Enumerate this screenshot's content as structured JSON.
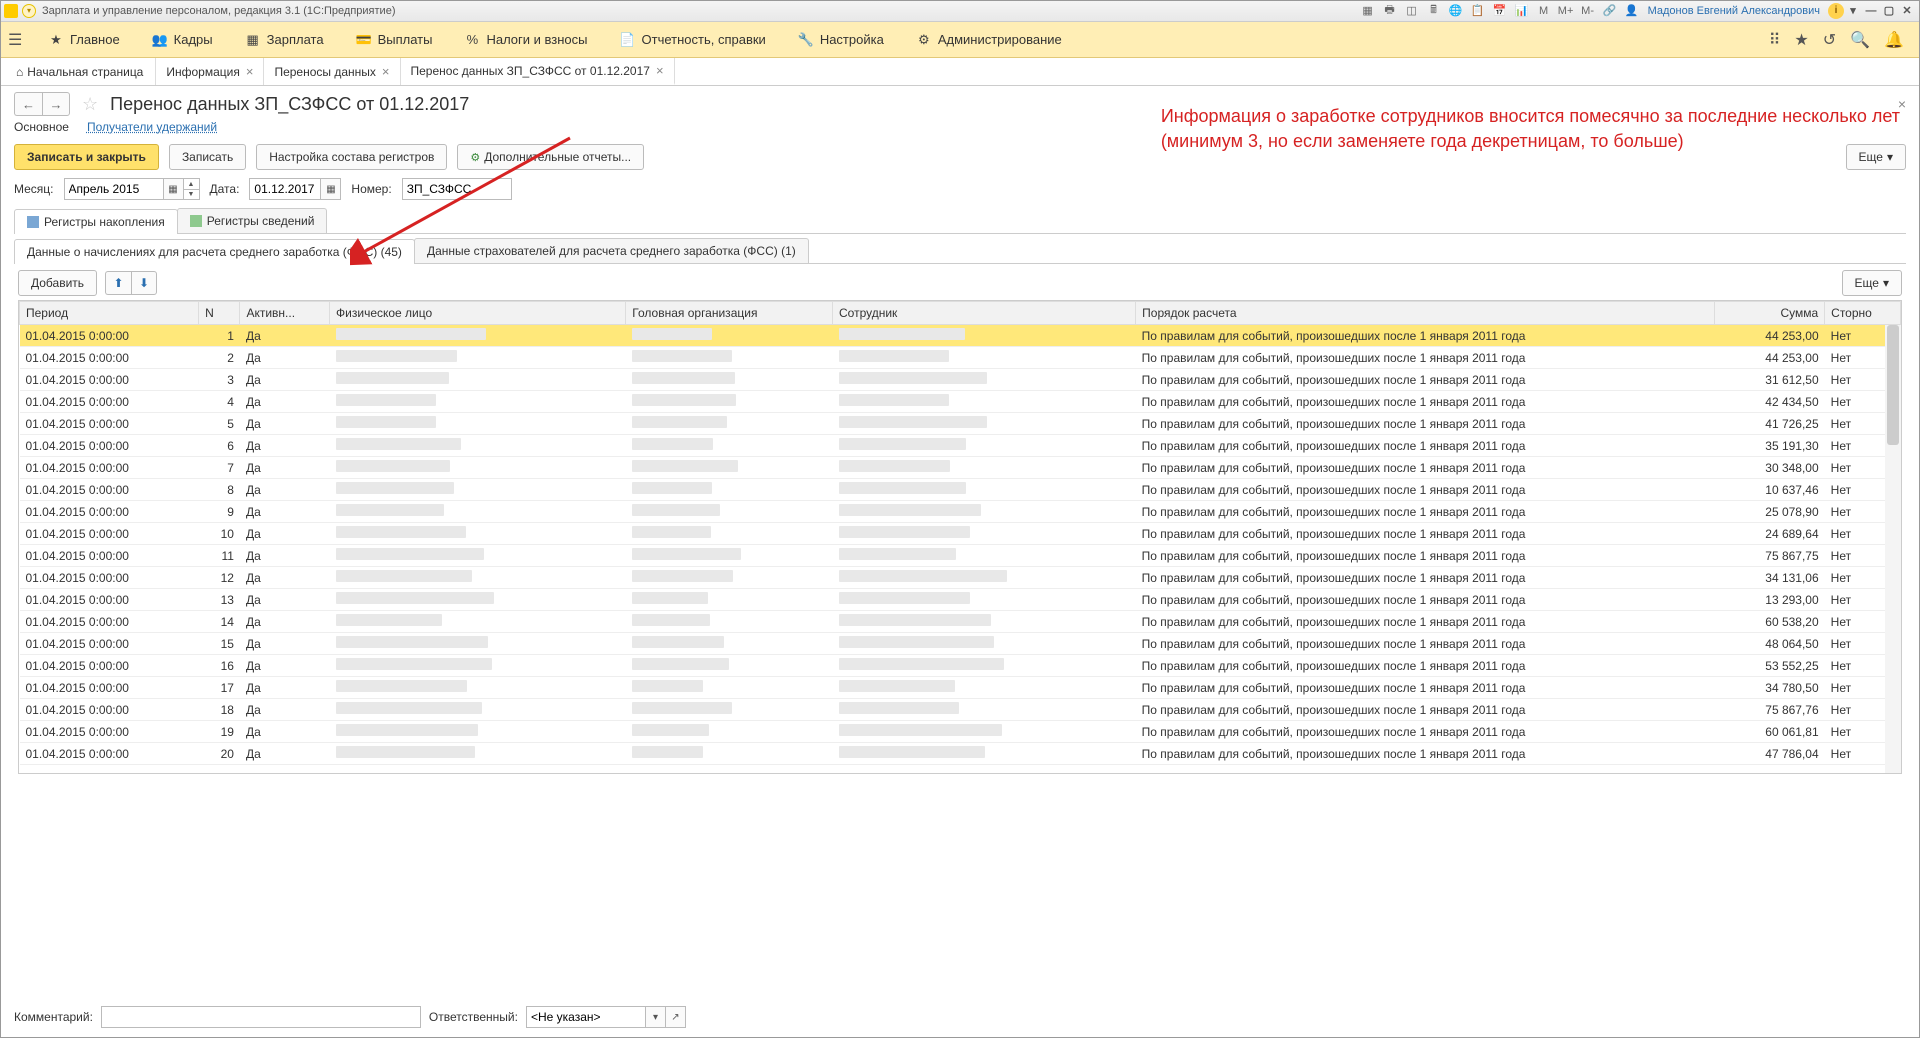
{
  "titlebar": {
    "title": "Зарплата и управление персоналом, редакция 3.1  (1С:Предприятие)",
    "user": "Мадонов Евгений Александрович",
    "m_items": [
      "M",
      "M+",
      "M-"
    ]
  },
  "menu": {
    "items": [
      {
        "label": "Главное",
        "icon": "★"
      },
      {
        "label": "Кадры",
        "icon": "👥"
      },
      {
        "label": "Зарплата",
        "icon": "▦"
      },
      {
        "label": "Выплаты",
        "icon": "💳"
      },
      {
        "label": "Налоги и взносы",
        "icon": "%"
      },
      {
        "label": "Отчетность, справки",
        "icon": "📄"
      },
      {
        "label": "Настройка",
        "icon": "🔧"
      },
      {
        "label": "Администрирование",
        "icon": "⚙"
      }
    ]
  },
  "tabs": {
    "home": "Начальная страница",
    "items": [
      {
        "label": "Информация"
      },
      {
        "label": "Переносы данных"
      },
      {
        "label": "Перенос данных ЗП_СЗФСС от 01.12.2017",
        "active": true
      }
    ]
  },
  "doc": {
    "title": "Перенос данных ЗП_СЗФСС от 01.12.2017",
    "sub_main": "Основное",
    "sub_link": "Получатели удержаний",
    "btn_save_close": "Записать и закрыть",
    "btn_save": "Записать",
    "btn_reg_setup": "Настройка состава регистров",
    "btn_reports": "Дополнительные отчеты...",
    "btn_more": "Еще",
    "month_lbl": "Месяц:",
    "month_val": "Апрель 2015",
    "date_lbl": "Дата:",
    "date_val": "01.12.2017",
    "num_lbl": "Номер:",
    "num_val": "ЗП_СЗФСС",
    "reg_accum": "Регистры накопления",
    "reg_info": "Регистры сведений",
    "subtab1": "Данные о начислениях для расчета среднего заработка (ФСС) (45)",
    "subtab2": "Данные страхователей для расчета среднего заработка (ФСС) (1)",
    "btn_add": "Добавить",
    "btn_more2": "Еще"
  },
  "table": {
    "headers": {
      "period": "Период",
      "n": "N",
      "active": "Активн...",
      "phys": "Физическое лицо",
      "org": "Головная организация",
      "emp": "Сотрудник",
      "order": "Порядок расчета",
      "sum": "Сумма",
      "storno": "Сторно"
    },
    "common": {
      "period": "01.04.2015 0:00:00",
      "active": "Да",
      "order": "По правилам для событий, произошедших после 1 января 2011 года",
      "storno": "Нет"
    },
    "rows": [
      {
        "n": 1,
        "sum": "44 253,00"
      },
      {
        "n": 2,
        "sum": "44 253,00"
      },
      {
        "n": 3,
        "sum": "31 612,50"
      },
      {
        "n": 4,
        "sum": "42 434,50"
      },
      {
        "n": 5,
        "sum": "41 726,25"
      },
      {
        "n": 6,
        "sum": "35 191,30"
      },
      {
        "n": 7,
        "sum": "30 348,00"
      },
      {
        "n": 8,
        "sum": "10 637,46"
      },
      {
        "n": 9,
        "sum": "25 078,90"
      },
      {
        "n": 10,
        "sum": "24 689,64"
      },
      {
        "n": 11,
        "sum": "75 867,75"
      },
      {
        "n": 12,
        "sum": "34 131,06"
      },
      {
        "n": 13,
        "sum": "13 293,00"
      },
      {
        "n": 14,
        "sum": "60 538,20"
      },
      {
        "n": 15,
        "sum": "48 064,50"
      },
      {
        "n": 16,
        "sum": "53 552,25"
      },
      {
        "n": 17,
        "sum": "34 780,50"
      },
      {
        "n": 18,
        "sum": "75 867,76"
      },
      {
        "n": 19,
        "sum": "60 061,81"
      },
      {
        "n": 20,
        "sum": "47 786,04"
      }
    ]
  },
  "bottom": {
    "comment_lbl": "Комментарий:",
    "resp_lbl": "Ответственный:",
    "resp_val": "<Не указан>"
  },
  "annotation": {
    "line1": "Информация о заработке сотрудников вносится помесячно за последние несколько лет",
    "line2": "(минимум 3, но если заменяете года декретницам, то больше)"
  }
}
